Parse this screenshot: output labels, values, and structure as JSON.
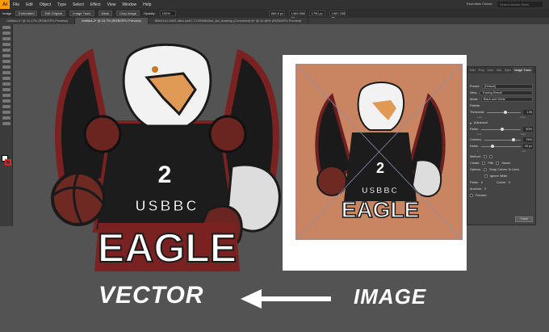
{
  "app": {
    "logo": "Ai"
  },
  "menu": [
    "File",
    "Edit",
    "Object",
    "Type",
    "Select",
    "Effect",
    "View",
    "Window",
    "Help"
  ],
  "workspace": "Essentials Classic",
  "search_placeholder": "Search Adobe Stock",
  "controlbar": {
    "items": [
      "Image",
      "Embedded",
      "Edit Original",
      "Image Trace",
      "Mask",
      "Crop Image",
      "Opacity:",
      "100%"
    ],
    "fields": [
      "869.8 px",
      "1362.056 px",
      "1790 px",
      "1987.238 px"
    ]
  },
  "tabs": [
    {
      "label": "Untitled-1* @ 11.17% (RGB/GPU Preview)",
      "active": false
    },
    {
      "label": "Untitled-2* @ 24.7% (RGB/GPU Preview)",
      "active": true
    },
    {
      "label": "8f9811e1-5d23-48cc-ae67-717f4f40e5a4_std_drawing (Converted).ai* @ 41.85% (RGB/GPU Preview)",
      "active": false
    }
  ],
  "panel": {
    "tabs": [
      "Tran",
      "Proj",
      "Colo",
      "Bru",
      "Sym",
      "Image Trace"
    ],
    "active_tab": "Image Trace",
    "preset_label": "Preset:",
    "preset_value": "[Default]",
    "view_label": "View:",
    "view_value": "Tracing Result",
    "mode_label": "Mode:",
    "mode_value": "Black and White",
    "palette_label": "Palette:",
    "threshold_label": "Threshold:",
    "threshold_value": 128,
    "threshold_less": "Less",
    "threshold_more": "More",
    "advanced_label": "Advanced",
    "paths_label": "Paths:",
    "paths_value": "50%",
    "paths_low": "Low",
    "paths_high": "High",
    "corners_label": "Corners:",
    "corners_value": "75%",
    "noise_label": "Noise:",
    "noise_value": "25 px",
    "noise_low": "1",
    "noise_high": "100",
    "method_label": "Method:",
    "create_label": "Create:",
    "fills_label": "Fills",
    "strokes_label": "Stroke",
    "options_label": "Options:",
    "snap_label": "Snap Curves To Lines",
    "ignore_white_label": "Ignore White",
    "paths_stat_label": "Paths:",
    "paths_stat_value": "0",
    "colors_stat_label": "Colors:",
    "colors_stat_value": "0",
    "anchors_stat_label": "Anchors:",
    "anchors_stat_value": "0",
    "preview_label": "Preview",
    "trace_button": "Trace"
  },
  "artwork": {
    "jersey_number": "2",
    "team_small": "USBBC",
    "team_large": "EAGLE"
  },
  "captions": {
    "left": "VECTOR",
    "right": "IMAGE"
  },
  "colors": {
    "canvas": "#535353",
    "maroon": "#7a2222",
    "image_bg": "#c98462",
    "accent": "#ff9a00"
  }
}
